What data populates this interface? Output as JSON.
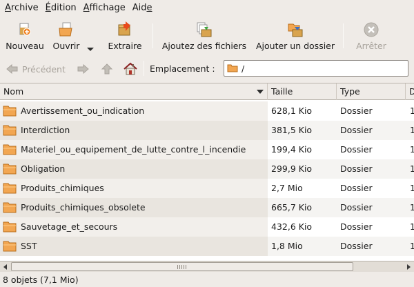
{
  "menubar": {
    "items": [
      {
        "label": "Archive",
        "mnemonic": "A",
        "rest": "rchive"
      },
      {
        "label": "Édition",
        "mnemonic": "É",
        "rest": "dition"
      },
      {
        "label": "Affichage",
        "mnemonic": "A",
        "rest": "ffichage"
      },
      {
        "label": "Aide",
        "mnemonic": "",
        "rest": "Aid",
        "tail": "e"
      }
    ]
  },
  "toolbar": {
    "new_label": "Nouveau",
    "open_label": "Ouvrir",
    "extract_label": "Extraire",
    "add_files_label": "Ajoutez des fichiers",
    "add_folder_label": "Ajouter un dossier",
    "stop_label": "Arrêter"
  },
  "locationbar": {
    "back_label": "Précédent",
    "location_label": "Emplacement :",
    "location_value": "/"
  },
  "columns": {
    "name": "Nom",
    "size": "Taille",
    "type": "Type",
    "date": "D"
  },
  "files": [
    {
      "name": "Avertissement_ou_indication",
      "size": "628,1 Kio",
      "type": "Dossier",
      "date": "1"
    },
    {
      "name": "Interdiction",
      "size": "381,5 Kio",
      "type": "Dossier",
      "date": "1"
    },
    {
      "name": "Materiel_ou_equipement_de_lutte_contre_l_incendie",
      "size": "199,4 Kio",
      "type": "Dossier",
      "date": "1"
    },
    {
      "name": "Obligation",
      "size": "299,9 Kio",
      "type": "Dossier",
      "date": "1"
    },
    {
      "name": "Produits_chimiques",
      "size": "2,7 Mio",
      "type": "Dossier",
      "date": "1"
    },
    {
      "name": "Produits_chimiques_obsolete",
      "size": "665,7 Kio",
      "type": "Dossier",
      "date": "1"
    },
    {
      "name": "Sauvetage_et_secours",
      "size": "432,6 Kio",
      "type": "Dossier",
      "date": "1"
    },
    {
      "name": "SST",
      "size": "1,8 Mio",
      "type": "Dossier",
      "date": "1"
    }
  ],
  "status": {
    "text": "8 objets (7,1 Mio)"
  },
  "colors": {
    "folder": "#f0a050",
    "disabled": "#a8a39c",
    "background": "#efebe7"
  }
}
